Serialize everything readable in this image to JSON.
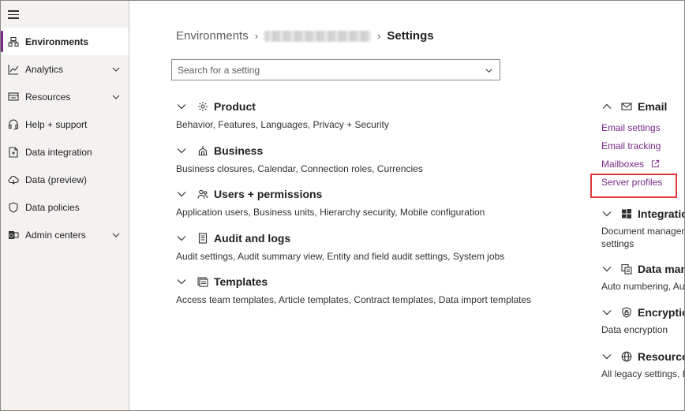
{
  "sidebar": {
    "items": [
      {
        "label": "Environments",
        "icon": "environments-icon",
        "selected": true
      },
      {
        "label": "Analytics",
        "icon": "analytics-icon",
        "expandable": true
      },
      {
        "label": "Resources",
        "icon": "resources-icon",
        "expandable": true
      },
      {
        "label": "Help + support",
        "icon": "headset-icon"
      },
      {
        "label": "Data integration",
        "icon": "data-integration-icon"
      },
      {
        "label": "Data (preview)",
        "icon": "cloud-data-icon"
      },
      {
        "label": "Data policies",
        "icon": "shield-icon"
      },
      {
        "label": "Admin centers",
        "icon": "admin-centers-icon",
        "expandable": true
      }
    ]
  },
  "breadcrumb": {
    "root": "Environments",
    "current": "Settings"
  },
  "search": {
    "placeholder": "Search for a setting"
  },
  "groups": [
    {
      "title": "Product",
      "icon": "gear-icon",
      "desc": "Behavior, Features, Languages, Privacy + Security"
    },
    {
      "title": "Business",
      "icon": "building-icon",
      "desc": "Business closures, Calendar, Connection roles, Currencies"
    },
    {
      "title": "Users + permissions",
      "icon": "people-icon",
      "desc": "Application users, Business units, Hierarchy security, Mobile configuration"
    },
    {
      "title": "Audit and logs",
      "icon": "document-icon",
      "desc": "Audit settings, Audit summary view, Entity and field audit settings, System jobs"
    },
    {
      "title": "Templates",
      "icon": "templates-icon",
      "desc": "Access team templates, Article templates, Contract templates, Data import templates"
    }
  ],
  "right_groups": {
    "email": {
      "title": "Email",
      "links": [
        "Email settings",
        "Email tracking",
        "Mailboxes",
        "Server profiles"
      ]
    },
    "integration": {
      "title": "Integration",
      "desc_1": "Document managem",
      "desc_2": "settings"
    },
    "data_management": {
      "title": "Data man",
      "desc": "Auto numbering, Au"
    },
    "encryption": {
      "title": "Encryption",
      "desc": "Data encryption"
    },
    "resources": {
      "title": "Resources",
      "desc": "All legacy settings, D"
    }
  },
  "colors": {
    "accent": "#7a2a8b",
    "highlight": "#e03a3a",
    "sidebar_bg": "#f3f2f1"
  }
}
